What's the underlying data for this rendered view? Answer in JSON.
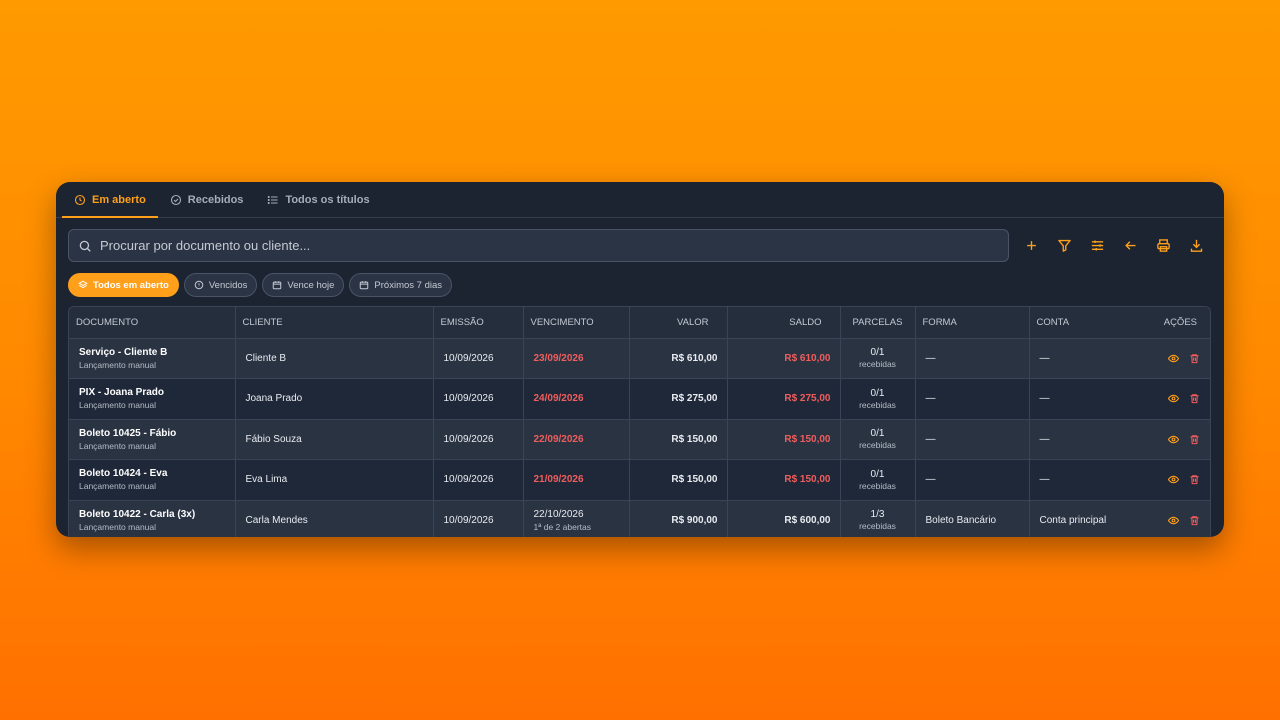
{
  "tabs": [
    {
      "label": "Em aberto",
      "icon": "clock-icon",
      "active": true
    },
    {
      "label": "Recebidos",
      "icon": "check-circle-icon",
      "active": false
    },
    {
      "label": "Todos os títulos",
      "icon": "list-icon",
      "active": false
    }
  ],
  "search": {
    "placeholder": "Procurar por documento ou cliente...",
    "value": ""
  },
  "toolbar_icons": [
    "plus-icon",
    "filter-icon",
    "sliders-icon",
    "arrow-left-icon",
    "print-icon",
    "download-icon"
  ],
  "chips": [
    {
      "label": "Todos em aberto",
      "icon": "layers-icon",
      "active": true
    },
    {
      "label": "Vencidos",
      "icon": "alert-circle-icon",
      "active": false
    },
    {
      "label": "Vence hoje",
      "icon": "calendar-icon",
      "active": false
    },
    {
      "label": "Próximos 7 dias",
      "icon": "calendar-icon",
      "active": false
    }
  ],
  "table": {
    "headers": [
      "DOCUMENTO",
      "CLIENTE",
      "EMISSÃO",
      "VENCIMENTO",
      "VALOR",
      "SALDO",
      "PARCELAS",
      "FORMA",
      "CONTA",
      "AÇÕES"
    ],
    "rows": [
      {
        "doc": "Serviço - Cliente B",
        "doc_sub": "Lançamento manual",
        "cliente": "Cliente B",
        "emissao": "10/09/2026",
        "vencimento": "23/09/2026",
        "venc_sub": "",
        "overdue": true,
        "valor": "R$ 610,00",
        "saldo": "R$ 610,00",
        "saldo_red": true,
        "parcelas": "0/1",
        "parcelas_sub": "recebidas",
        "forma": "—",
        "conta": "—"
      },
      {
        "doc": "PIX - Joana Prado",
        "doc_sub": "Lançamento manual",
        "cliente": "Joana Prado",
        "emissao": "10/09/2026",
        "vencimento": "24/09/2026",
        "venc_sub": "",
        "overdue": true,
        "valor": "R$ 275,00",
        "saldo": "R$ 275,00",
        "saldo_red": true,
        "parcelas": "0/1",
        "parcelas_sub": "recebidas",
        "forma": "—",
        "conta": "—"
      },
      {
        "doc": "Boleto 10425 - Fábio",
        "doc_sub": "Lançamento manual",
        "cliente": "Fábio Souza",
        "emissao": "10/09/2026",
        "vencimento": "22/09/2026",
        "venc_sub": "",
        "overdue": true,
        "valor": "R$ 150,00",
        "saldo": "R$ 150,00",
        "saldo_red": true,
        "parcelas": "0/1",
        "parcelas_sub": "recebidas",
        "forma": "—",
        "conta": "—"
      },
      {
        "doc": "Boleto 10424 - Eva",
        "doc_sub": "Lançamento manual",
        "cliente": "Eva Lima",
        "emissao": "10/09/2026",
        "vencimento": "21/09/2026",
        "venc_sub": "",
        "overdue": true,
        "valor": "R$ 150,00",
        "saldo": "R$ 150,00",
        "saldo_red": true,
        "parcelas": "0/1",
        "parcelas_sub": "recebidas",
        "forma": "—",
        "conta": "—"
      },
      {
        "doc": "Boleto 10422 - Carla (3x)",
        "doc_sub": "Lançamento manual",
        "cliente": "Carla Mendes",
        "emissao": "10/09/2026",
        "vencimento": "22/10/2026",
        "venc_sub": "1ª de 2 abertas",
        "overdue": false,
        "valor": "R$ 900,00",
        "saldo": "R$ 600,00",
        "saldo_red": false,
        "parcelas": "1/3",
        "parcelas_sub": "recebidas",
        "forma": "Boleto Bancário",
        "conta": "Conta principal"
      }
    ],
    "row_action_icons": [
      "eye-icon",
      "trash-icon"
    ]
  },
  "colors": {
    "accent": "#ff9f1a",
    "overdue": "#f05d5d",
    "panel": "#1c2432"
  }
}
